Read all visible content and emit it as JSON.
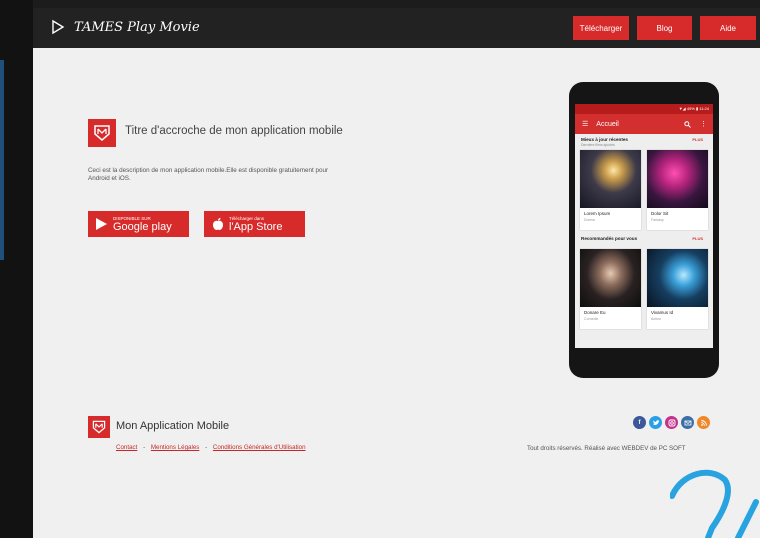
{
  "header": {
    "brand": "TAMES Play Movie",
    "nav": [
      "Télécharger",
      "Blog",
      "Aide"
    ]
  },
  "hero": {
    "title": "Titre d'accroche de mon application mobile",
    "description": "Ceci est la description de mon application mobile.Elle est disponible gratuitement pour Android et iOS.",
    "google_play": {
      "small": "DISPONIBLE SUR",
      "big": "Google play"
    },
    "app_store": {
      "small": "Télécharger dans",
      "big": "l'App Store"
    }
  },
  "phone": {
    "status": "▼◢ 45% ▮ 11:24",
    "app_title": "Accueil",
    "section1": {
      "title": "Mieux à jour récentes",
      "subtitle": "Dernière films ajoutés",
      "more": "PLUS"
    },
    "section2": {
      "title": "Recommandés pour vous",
      "more": "PLUS"
    },
    "cards": [
      {
        "title": "Lorem Ipsum",
        "subtitle": "Drama"
      },
      {
        "title": "Dolor Sit",
        "subtitle": "Fantasy"
      },
      {
        "title": "Donare Eu",
        "subtitle": "Comedie"
      },
      {
        "title": "Vivamus Id",
        "subtitle": "Action"
      }
    ]
  },
  "footer": {
    "title": "Mon Application Mobile",
    "links": [
      "Contact",
      "Mentions Légales",
      "Conditions Générales d'Utilisation"
    ],
    "separator": "-",
    "copyright": "Tout droits réservés. Réalisé avec WEBDEV de PC SOFT",
    "social_icons": [
      "facebook-icon",
      "twitter-icon",
      "instagram-icon",
      "email-icon",
      "rss-icon"
    ]
  },
  "colors": {
    "accent": "#d72a2a",
    "header_bg": "#222222",
    "page_bg": "#f0f0f0"
  }
}
